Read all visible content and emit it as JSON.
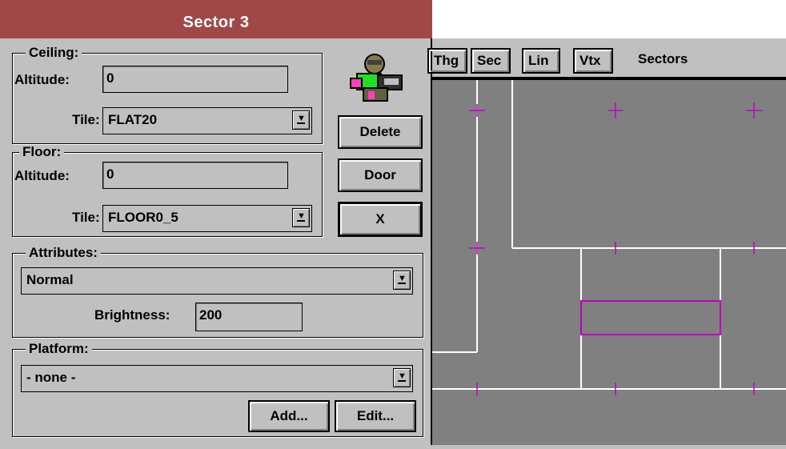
{
  "dialog": {
    "title": "Sector 3",
    "ceiling": {
      "legend": "Ceiling:",
      "altitude_label": "Altitude:",
      "altitude_value": "0",
      "tile_label": "Tile:",
      "tile_value": "FLAT20"
    },
    "floor": {
      "legend": "Floor:",
      "altitude_label": "Altitude:",
      "altitude_value": "0",
      "tile_label": "Tile:",
      "tile_value": "FLOOR0_5"
    },
    "attributes": {
      "legend": "Attributes:",
      "value": "Normal",
      "brightness_label": "Brightness:",
      "brightness_value": "200"
    },
    "platform": {
      "legend": "Platform:",
      "value": "- none -",
      "add_label": "Add...",
      "edit_label": "Edit..."
    },
    "buttons": {
      "delete": "Delete",
      "door": "Door",
      "close": "X"
    }
  },
  "toolbar": {
    "tabs": [
      "Thg",
      "Sec",
      "Lin",
      "Vtx"
    ],
    "mode": "Sectors"
  },
  "colors": {
    "titlebar": "#a04848",
    "canvas": "#808080",
    "line": "#ffffff",
    "vertex": "#c000c0",
    "selected_sector": "#c000c0"
  }
}
